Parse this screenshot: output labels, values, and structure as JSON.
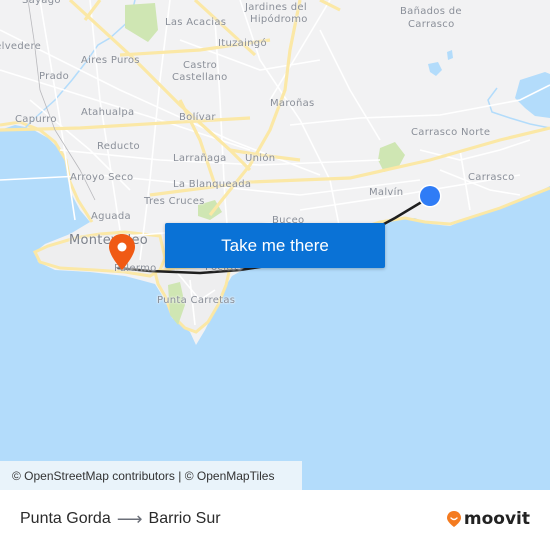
{
  "map": {
    "colors": {
      "land": "#f2f2f3",
      "water": "#b3dcfb",
      "major_road": "#fbe8a6",
      "minor_road": "#ffffff",
      "park": "#cfe6b3",
      "route_line": "#1f1f1f",
      "origin_marker": "#2f7cf6",
      "destination_marker": "#f05a14",
      "cta_background": "#0a72d6"
    },
    "places": [
      {
        "id": "sayago",
        "label": "Sayago"
      },
      {
        "id": "las-acacias",
        "label": "Las Acacias"
      },
      {
        "id": "jardines-del-hipodromo-1",
        "label": "Jardines del"
      },
      {
        "id": "jardines-del-hipodromo-2",
        "label": "Hipódromo"
      },
      {
        "id": "banados-de-carrasco-1",
        "label": "Bañados de"
      },
      {
        "id": "banados-de-carrasco-2",
        "label": "Carrasco"
      },
      {
        "id": "belvedere",
        "label": "Belvedere"
      },
      {
        "id": "ituzaingo",
        "label": "Ituzaingó"
      },
      {
        "id": "aires-puros",
        "label": "Aires Puros"
      },
      {
        "id": "castro-castellano-1",
        "label": "Castro"
      },
      {
        "id": "castro-castellano-2",
        "label": "Castellano"
      },
      {
        "id": "prado",
        "label": "Prado"
      },
      {
        "id": "maronas",
        "label": "Maroñas"
      },
      {
        "id": "atahualpa",
        "label": "Atahualpa"
      },
      {
        "id": "bolivar",
        "label": "Bolívar"
      },
      {
        "id": "capurro",
        "label": "Capurro"
      },
      {
        "id": "carrasco-norte",
        "label": "Carrasco Norte"
      },
      {
        "id": "reducto",
        "label": "Reducto"
      },
      {
        "id": "larranaga",
        "label": "Larrañaga"
      },
      {
        "id": "union",
        "label": "Unión"
      },
      {
        "id": "arroyo-seco",
        "label": "Arroyo Seco"
      },
      {
        "id": "carrasco",
        "label": "Carrasco"
      },
      {
        "id": "la-blanqueada",
        "label": "La Blanqueada"
      },
      {
        "id": "malvin",
        "label": "Malvín"
      },
      {
        "id": "tres-cruces",
        "label": "Tres Cruces"
      },
      {
        "id": "aguada",
        "label": "Aguada"
      },
      {
        "id": "buceo",
        "label": "Buceo"
      },
      {
        "id": "montevideo",
        "label": "Montevideo"
      },
      {
        "id": "palermo",
        "label": "Palermo"
      },
      {
        "id": "pocitos",
        "label": "Pocitos"
      },
      {
        "id": "punta-carretas",
        "label": "Punta Carretas"
      }
    ],
    "origin": {
      "name": "Punta Gorda",
      "icon": "current-location-dot-icon"
    },
    "destination": {
      "name": "Barrio Sur",
      "icon": "map-pin-icon"
    },
    "cta_label": "Take me there",
    "attribution": "© OpenStreetMap contributors | © OpenMapTiles"
  },
  "footer": {
    "origin": "Punta Gorda",
    "arrow_icon": "arrow-right-icon",
    "destination": "Barrio Sur",
    "logo_text": "moovit",
    "logo_icon": "moovit-pin-icon"
  }
}
